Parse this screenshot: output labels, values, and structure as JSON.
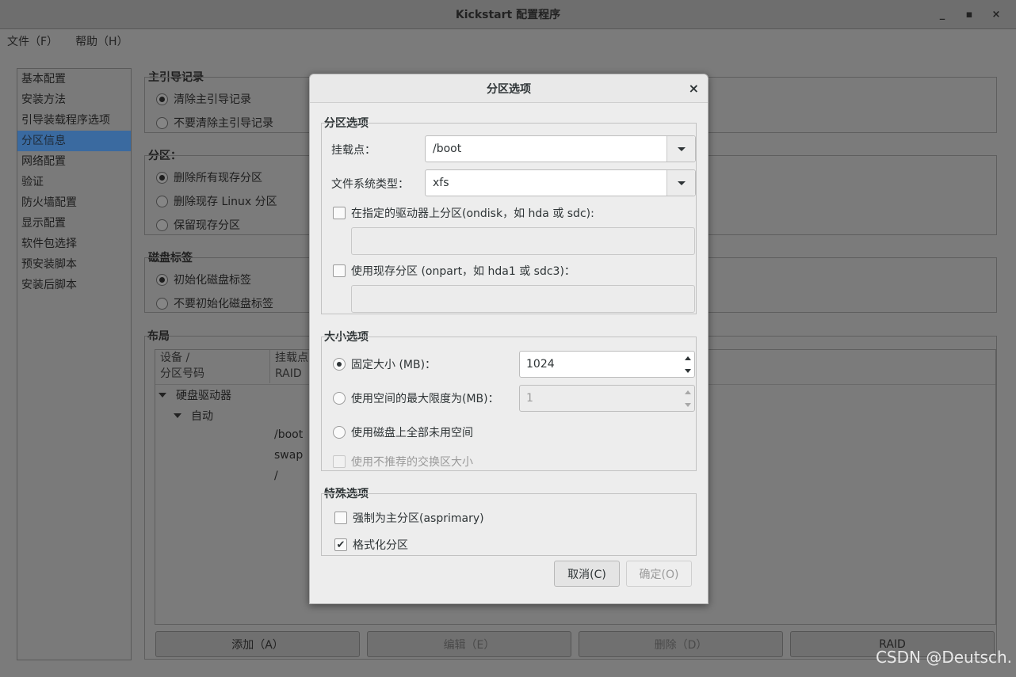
{
  "window": {
    "title": "Kickstart 配置程序",
    "controls": {
      "minimize": "_",
      "maximize": "▪",
      "close": "×"
    }
  },
  "menubar": {
    "items": [
      {
        "label": "文件（F）"
      },
      {
        "label": "帮助（H）"
      }
    ]
  },
  "sidebar": {
    "selected_index": 3,
    "items": [
      {
        "label": "基本配置"
      },
      {
        "label": "安装方法"
      },
      {
        "label": "引导装载程序选项"
      },
      {
        "label": "分区信息"
      },
      {
        "label": "网络配置"
      },
      {
        "label": "验证"
      },
      {
        "label": "防火墙配置"
      },
      {
        "label": "显示配置"
      },
      {
        "label": "软件包选择"
      },
      {
        "label": "预安装脚本"
      },
      {
        "label": "安装后脚本"
      }
    ]
  },
  "main": {
    "mbr": {
      "title": "主引导记录",
      "options": [
        {
          "label": "清除主引导记录",
          "checked": true
        },
        {
          "label": "不要清除主引导记录",
          "checked": false
        }
      ]
    },
    "partitions": {
      "title": "分区：",
      "options": [
        {
          "label": "删除所有现存分区",
          "checked": true
        },
        {
          "label": "删除现存  Linux 分区",
          "checked": false
        },
        {
          "label": "保留现存分区",
          "checked": false
        }
      ]
    },
    "disklabel": {
      "title": "磁盘标签",
      "options": [
        {
          "label": "初始化磁盘标签",
          "checked": true
        },
        {
          "label": "不要初始化磁盘标签",
          "checked": false
        }
      ]
    },
    "layout": {
      "title": "布局",
      "columns": [
        {
          "line1": "设备 /",
          "line2": "分区号码"
        },
        {
          "line1": "挂载点",
          "line2": "RAID"
        }
      ],
      "tree": {
        "drives_label": "硬盘驱动器",
        "auto_label": "自动",
        "mounts": [
          "/boot",
          "swap",
          "/"
        ]
      }
    },
    "buttons": {
      "add": "添加（A）",
      "edit": "编辑（E）",
      "delete": "删除（D）",
      "raid": "RAID"
    }
  },
  "dialog": {
    "title": "分区选项",
    "close": "×",
    "partition_options": {
      "title": "分区选项",
      "mount_label": "挂载点：",
      "mount_value": "/boot",
      "fstype_label": "文件系统类型：",
      "fstype_value": "xfs",
      "ondisk_label": "在指定的驱动器上分区(ondisk，如  hda 或  sdc):",
      "ondisk_checked": false,
      "onpart_label": "使用现存分区 (onpart，如  hda1 或  sdc3)：",
      "onpart_checked": false
    },
    "size_options": {
      "title": "大小选项",
      "fixed_label": "固定大小 (MB)：",
      "fixed_checked": true,
      "fixed_value": "1024",
      "max_label": "使用空间的最大限度为(MB)：",
      "max_checked": false,
      "max_value": "1",
      "all_label": "使用磁盘上全部未用空间",
      "all_checked": false,
      "swap_label": "使用不推荐的交换区大小",
      "swap_checked": false
    },
    "special_options": {
      "title": "特殊选项",
      "primary_label": "强制为主分区(asprimary)",
      "primary_checked": false,
      "format_label": "格式化分区",
      "format_checked": true
    },
    "buttons": {
      "cancel": "取消(C)",
      "ok": "确定(O)"
    }
  },
  "watermark": "CSDN @Deutsch."
}
